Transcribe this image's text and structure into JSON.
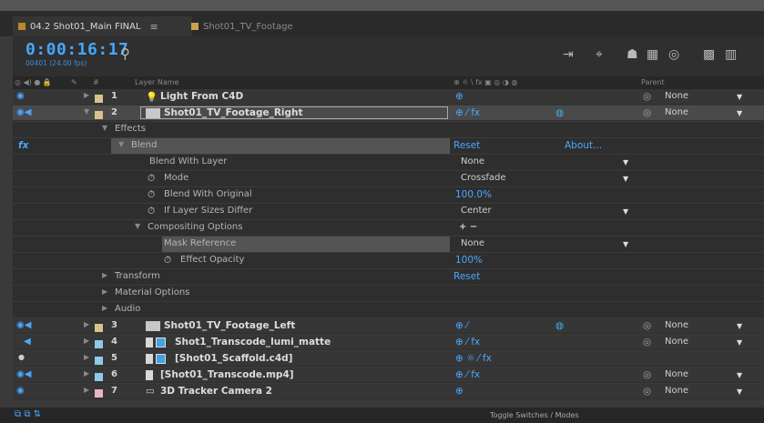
{
  "tabs": [
    {
      "label": "04.2 Shot01_Main FINAL",
      "menu": "≡",
      "color": "#b88a2c"
    },
    {
      "label": "Shot01_TV_Footage",
      "color": "#c9a24b"
    }
  ],
  "header": {
    "timecode": "0:00:16:17",
    "frame_info": "00401 (24.00 fps)",
    "search_icon": "search-icon",
    "toolbar_icons": [
      "comp-mini-flowchart-icon",
      "draft-3d-icon",
      "shy-layers-icon",
      "frame-blending-icon",
      "motion-blur-icon",
      "graph-editor-icon",
      "render-icon"
    ]
  },
  "columns": {
    "av": "◎ ◀) ● 🔒",
    "label": "✎",
    "hash": "#",
    "layer_name": "Layer Name",
    "switches": "⊕ ☼ \\ fx ▣ ◎ ◑ ◍",
    "parent": "Parent"
  },
  "layers": [
    {
      "index": "1",
      "name": "Light From C4D",
      "color": "#d9c28e",
      "switches": "⊕",
      "parent": "None"
    },
    {
      "index": "2",
      "name": "Shot01_TV_Footage_Right",
      "color": "#d9c28e",
      "switches": "⊕  ⁄ fx",
      "parent": "None"
    },
    {
      "index": "3",
      "name": "Shot01_TV_Footage_Left",
      "color": "#d9c28e",
      "switches": "⊕  ⁄",
      "parent": "None"
    },
    {
      "index": "4",
      "name": "Shot1_Transcode_lumi_matte",
      "color": "#8ecae6",
      "switches": "⊕  ⁄ fx",
      "parent": "None"
    },
    {
      "index": "5",
      "name": "[Shot01_Scaffold.c4d]",
      "color": "#8ecae6",
      "switches": "⊕ ☼ ⁄ fx",
      "parent": ""
    },
    {
      "index": "6",
      "name": "[Shot01_Transcode.mp4]",
      "color": "#8ecae6",
      "switches": "⊕  ⁄ fx",
      "parent": "None"
    },
    {
      "index": "7",
      "name": "3D Tracker Camera 2",
      "color": "#e8b4c8",
      "switches": "⊕",
      "parent": "None"
    }
  ],
  "effects": {
    "group": "Effects",
    "fx": "fx",
    "blend": {
      "name": "Blend",
      "reset": "Reset",
      "about": "About...",
      "props": [
        {
          "label": "Blend With Layer",
          "value": "None",
          "dropdown": true
        },
        {
          "label": "Mode",
          "value": "Crossfade",
          "dropdown": true
        },
        {
          "label": "Blend With Original",
          "value": "100.0%",
          "dropdown": false
        },
        {
          "label": "If Layer Sizes Differ",
          "value": "Center",
          "dropdown": true
        }
      ],
      "compositing": {
        "label": "Compositing Options",
        "value": "+ −",
        "mask_reference": {
          "label": "Mask Reference",
          "value": "None"
        },
        "effect_opacity": {
          "label": "Effect Opacity",
          "value": "100%"
        }
      }
    }
  },
  "groups": {
    "transform": "Transform",
    "transform_reset": "Reset",
    "material": "Material Options",
    "audio": "Audio"
  },
  "bottom": {
    "toggle_label": "Toggle Switches / Modes"
  }
}
